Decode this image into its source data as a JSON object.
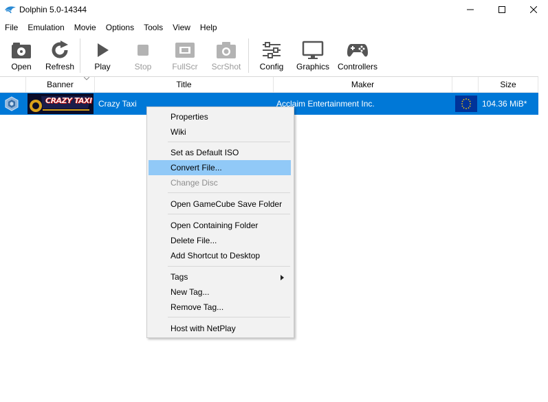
{
  "window": {
    "title": "Dolphin 5.0-14344"
  },
  "menubar": {
    "items": [
      "File",
      "Emulation",
      "Movie",
      "Options",
      "Tools",
      "View",
      "Help"
    ]
  },
  "toolbar": {
    "open": "Open",
    "refresh": "Refresh",
    "play": "Play",
    "stop": "Stop",
    "fullscr": "FullScr",
    "scrshot": "ScrShot",
    "config": "Config",
    "graphics": "Graphics",
    "controllers": "Controllers"
  },
  "table": {
    "headers": {
      "banner": "Banner",
      "title": "Title",
      "maker": "Maker",
      "size": "Size"
    },
    "rows": [
      {
        "banner_text": "CRAZY TAXI",
        "title": "Crazy Taxi",
        "maker": "Acclaim Entertainment Inc.",
        "size": "104.36 MiB*"
      }
    ]
  },
  "context_menu": {
    "properties": "Properties",
    "wiki": "Wiki",
    "set_default_iso": "Set as Default ISO",
    "convert_file": "Convert File...",
    "change_disc": "Change Disc",
    "open_save_folder": "Open GameCube Save Folder",
    "open_containing_folder": "Open Containing Folder",
    "delete_file": "Delete File...",
    "add_shortcut": "Add Shortcut to Desktop",
    "tags": "Tags",
    "new_tag": "New Tag...",
    "remove_tag": "Remove Tag...",
    "host_netplay": "Host with NetPlay"
  },
  "colors": {
    "selection": "#0078d7",
    "menu_highlight": "#91c9f7",
    "eu_flag": "#003399"
  }
}
